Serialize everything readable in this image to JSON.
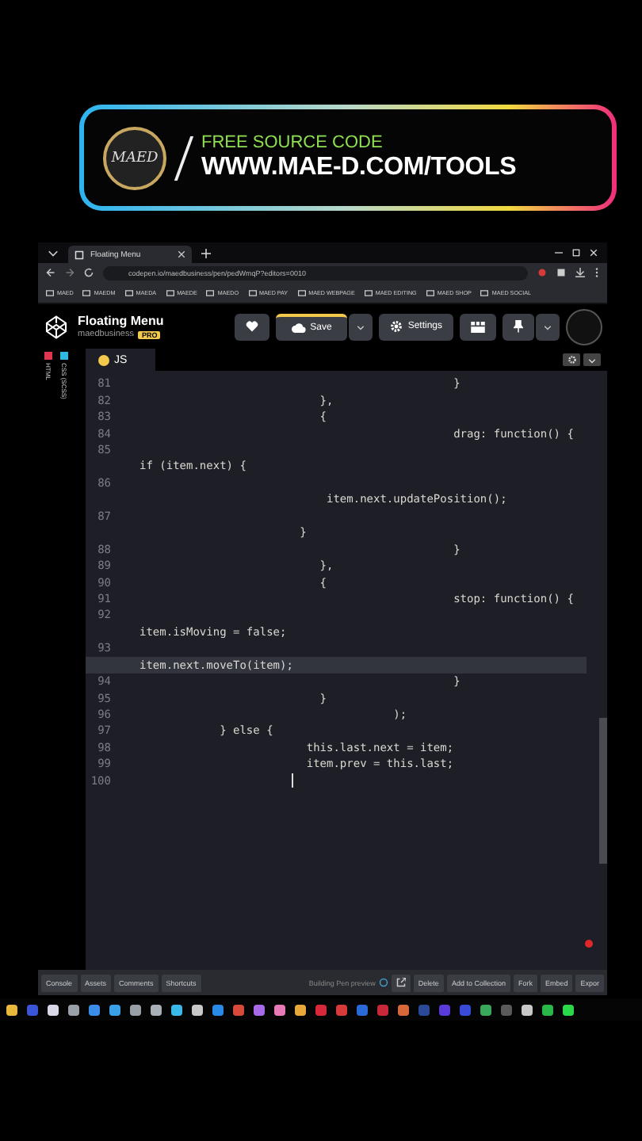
{
  "banner": {
    "logo_text": "MAED",
    "subtitle": "FREE SOURCE CODE",
    "url": "WWW.MAE-D.COM/TOOLS"
  },
  "browser": {
    "tab_title": "Floating Menu",
    "url": "codepen.io/maedbusiness/pen/pedWmqP?editors=0010",
    "bookmarks": [
      "MAED",
      "MAEDM",
      "MAEDA",
      "MAEDE",
      "MAEDO",
      "MAED PAY",
      "MAED WEBPAGE",
      "MAED EDITING",
      "MAED SHOP",
      "MAED SOCIAL"
    ]
  },
  "pen": {
    "title": "Floating Menu",
    "owner": "maedbusiness",
    "badge": "PRO",
    "save": "Save",
    "settings": "Settings"
  },
  "side_tabs": [
    {
      "label": "HTML",
      "color": "#e0364f"
    },
    {
      "label": "CSS (SCSS)",
      "color": "#2fb8e0"
    }
  ],
  "editor": {
    "tab": "JS",
    "lines": [
      {
        "number": "81",
        "text": "                                               }",
        "wrapped": false,
        "highlighted": false,
        "cursor": false
      },
      {
        "number": "82",
        "text": "                           },",
        "wrapped": false,
        "highlighted": false,
        "cursor": false
      },
      {
        "number": "83",
        "text": "                           {",
        "wrapped": false,
        "highlighted": false,
        "cursor": false
      },
      {
        "number": "84",
        "text": "                                               drag: function() {",
        "wrapped": false,
        "highlighted": false,
        "cursor": false
      },
      {
        "number": "85",
        "text": "if (item.next) {",
        "wrapped": true,
        "highlighted": false,
        "cursor": false
      },
      {
        "number": "86",
        "text": "                            item.next.updatePosition();",
        "wrapped": true,
        "highlighted": false,
        "cursor": false
      },
      {
        "number": "87",
        "text": "                        }",
        "wrapped": true,
        "highlighted": false,
        "cursor": false
      },
      {
        "number": "88",
        "text": "                                               }",
        "wrapped": false,
        "highlighted": false,
        "cursor": false
      },
      {
        "number": "89",
        "text": "                           },",
        "wrapped": false,
        "highlighted": false,
        "cursor": false
      },
      {
        "number": "90",
        "text": "                           {",
        "wrapped": false,
        "highlighted": false,
        "cursor": false
      },
      {
        "number": "91",
        "text": "                                               stop: function() {",
        "wrapped": false,
        "highlighted": false,
        "cursor": false
      },
      {
        "number": "92",
        "text": "item.isMoving = false;",
        "wrapped": true,
        "highlighted": false,
        "cursor": false
      },
      {
        "number": "93",
        "text": "item.next.moveTo(item);",
        "wrapped": true,
        "highlighted": true,
        "cursor": false
      },
      {
        "number": "94",
        "text": "                                               }",
        "wrapped": false,
        "highlighted": false,
        "cursor": false
      },
      {
        "number": "95",
        "text": "                           }",
        "wrapped": false,
        "highlighted": false,
        "cursor": false
      },
      {
        "number": "96",
        "text": "                                      );",
        "wrapped": false,
        "highlighted": false,
        "cursor": false
      },
      {
        "number": "97",
        "text": "            } else {",
        "wrapped": false,
        "highlighted": false,
        "cursor": false
      },
      {
        "number": "98",
        "text": "                         this.last.next = item;",
        "wrapped": false,
        "highlighted": false,
        "cursor": false
      },
      {
        "number": "99",
        "text": "                         item.prev = this.last;",
        "wrapped": false,
        "highlighted": false,
        "cursor": false
      },
      {
        "number": "100",
        "wrapped": false,
        "highlighted": false,
        "cursor": true
      }
    ]
  },
  "footer": {
    "left_buttons": [
      "Console",
      "Assets",
      "Comments",
      "Shortcuts"
    ],
    "status": "Building Pen preview",
    "right_buttons": [
      "Delete",
      "Add to Collection",
      "Fork",
      "Embed",
      "Expor"
    ]
  }
}
